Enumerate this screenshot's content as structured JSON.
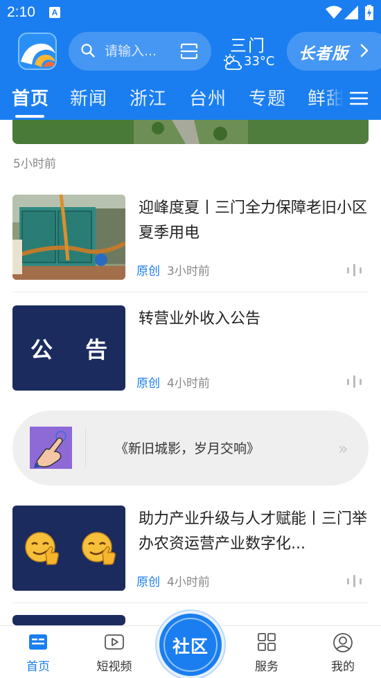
{
  "status_bar": {
    "time": "2:10",
    "notification_badge": "A"
  },
  "header": {
    "search_placeholder": "请输入...",
    "weather": {
      "city": "三门",
      "temperature": "33°C",
      "icon": "partly-cloudy-icon"
    },
    "elder_mode_label": "长者版",
    "tabs": [
      "首页",
      "新闻",
      "浙江",
      "台州",
      "专题",
      "鲜甜"
    ],
    "active_tab": "首页"
  },
  "feed": {
    "top_card_time": "5小时前",
    "articles": [
      {
        "title": "迎峰度夏丨三门全力保障老旧小区夏季用电",
        "tag": "原创",
        "time": "3小时前"
      },
      {
        "title": "转营业外收入公告",
        "tag": "原创",
        "time": "4小时前",
        "thumb_text": "公 告"
      },
      {
        "title": "助力产业升级与人才赋能丨三门举办农资运营产业数字化...",
        "tag": "原创",
        "time": "4小时前"
      }
    ],
    "topic_banner": {
      "text": "《新旧城影，岁月交响》",
      "arrow": "»"
    }
  },
  "bottom_nav": {
    "items": [
      {
        "label": "首页",
        "icon": "home-icon"
      },
      {
        "label": "短视频",
        "icon": "video-icon"
      },
      {
        "label": "社区",
        "icon": "community-icon"
      },
      {
        "label": "服务",
        "icon": "grid-icon"
      },
      {
        "label": "我的",
        "icon": "profile-icon"
      }
    ],
    "active": "首页"
  },
  "colors": {
    "brand_blue": "#1a7ef0",
    "notice_navy": "#1b2b5e",
    "tag_blue": "#1a7ef0"
  }
}
